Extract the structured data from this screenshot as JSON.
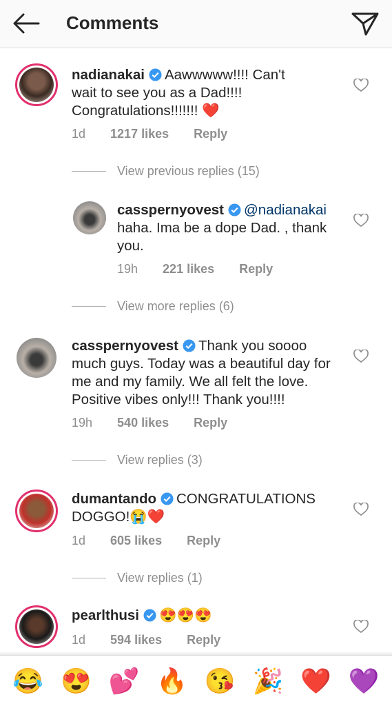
{
  "header": {
    "title": "Comments"
  },
  "comments": [
    {
      "username": "nadianakai",
      "text": "Aawwwww!!!! Can't wait to see you as a Dad!!!! Congratulations!!!!!!! ❤️",
      "time": "1d",
      "likes": "1217 likes",
      "reply": "Reply",
      "view_replies": "View previous replies (15)"
    },
    {
      "username": "casspernyovest",
      "mention": "@nadianakai",
      "text": "haha. Ima be a dope Dad. , thank you.",
      "time": "19h",
      "likes": "221 likes",
      "reply": "Reply",
      "view_replies": "View more replies (6)"
    },
    {
      "username": "casspernyovest",
      "text": "Thank you soooo much guys. Today was a beautiful day for me and my family. We all felt the love. Positive vibes only!!! Thank you!!!!",
      "time": "19h",
      "likes": "540 likes",
      "reply": "Reply",
      "view_replies": "View replies (3)"
    },
    {
      "username": "dumantando",
      "text": "CONGRATULATIONS DOGGO!😭❤️",
      "time": "1d",
      "likes": "605 likes",
      "reply": "Reply",
      "view_replies": "View replies (1)"
    },
    {
      "username": "pearlthusi",
      "text": "😍😍😍",
      "time": "1d",
      "likes": "594 likes",
      "reply": "Reply"
    }
  ],
  "emoji_bar": [
    "😂",
    "😍",
    "💕",
    "🔥",
    "😘",
    "🎉",
    "❤️",
    "💜"
  ],
  "colors": {
    "verified": "#3897f0",
    "heart": "#e0245e",
    "story_ring": "#e1306c"
  }
}
